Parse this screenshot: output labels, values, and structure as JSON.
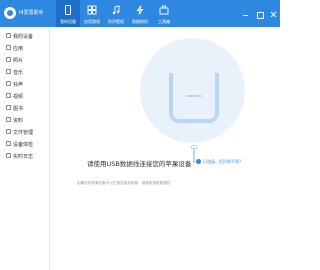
{
  "app": {
    "title": "i4爱思助手",
    "accent_color": "#2f88e0",
    "active_tab_color": "#1e6fc7"
  },
  "tabs": [
    {
      "label": "我的设备",
      "icon": "device-icon",
      "active": true
    },
    {
      "label": "应用游戏",
      "icon": "apps-icon",
      "active": false
    },
    {
      "label": "铃声壁纸",
      "icon": "music-icon",
      "active": false
    },
    {
      "label": "智能刷机",
      "icon": "flash-icon",
      "active": false
    },
    {
      "label": "工具箱",
      "icon": "toolbox-icon",
      "active": false
    }
  ],
  "window_controls": [
    "minimize-icon",
    "maximize-icon",
    "close-icon"
  ],
  "sidebar": {
    "items": [
      {
        "label": "我的设备",
        "icon": "device-icon"
      },
      {
        "label": "应用",
        "icon": "apps-icon"
      },
      {
        "label": "照片",
        "icon": "photo-icon"
      },
      {
        "label": "音乐",
        "icon": "music-icon"
      },
      {
        "label": "铃声",
        "icon": "bell-icon"
      },
      {
        "label": "视频",
        "icon": "video-icon"
      },
      {
        "label": "图书",
        "icon": "book-icon"
      },
      {
        "label": "资料",
        "icon": "contacts-icon"
      },
      {
        "label": "文件管理",
        "icon": "folder-icon"
      },
      {
        "label": "设备体检",
        "icon": "check-icon"
      },
      {
        "label": "实时日志",
        "icon": "log-icon"
      }
    ]
  },
  "main": {
    "connect_message": "请使用USB数据线连接您的苹果设备",
    "help_link": "已连接，但识别不到?",
    "footnote": "如果您的苹果设备可以正常连接到电脑，请重新插拔数据线"
  }
}
